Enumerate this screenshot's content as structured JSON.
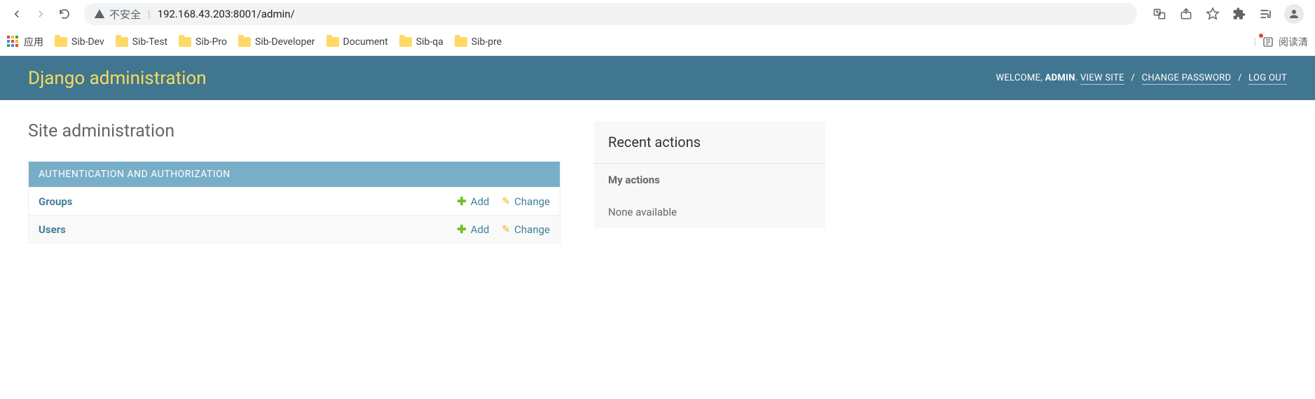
{
  "browser": {
    "insecure_label": "不安全",
    "url": "192.168.43.203:8001/admin/"
  },
  "bookmarks": {
    "apps_label": "应用",
    "items": [
      {
        "label": "Sib-Dev"
      },
      {
        "label": "Sib-Test"
      },
      {
        "label": "Sib-Pro"
      },
      {
        "label": "Sib-Developer"
      },
      {
        "label": "Document"
      },
      {
        "label": "Sib-qa"
      },
      {
        "label": "Sib-pre"
      }
    ],
    "reading_list_label": "阅读清"
  },
  "header": {
    "title": "Django administration",
    "welcome": "WELCOME,",
    "username": "ADMIN",
    "view_site": "VIEW SITE",
    "change_password": "CHANGE PASSWORD",
    "logout": "LOG OUT"
  },
  "page": {
    "title": "Site administration"
  },
  "module": {
    "header": "AUTHENTICATION AND AUTHORIZATION",
    "rows": [
      {
        "name": "Groups",
        "add": "Add",
        "change": "Change"
      },
      {
        "name": "Users",
        "add": "Add",
        "change": "Change"
      }
    ]
  },
  "sidebar": {
    "recent_actions": "Recent actions",
    "my_actions": "My actions",
    "none": "None available"
  }
}
